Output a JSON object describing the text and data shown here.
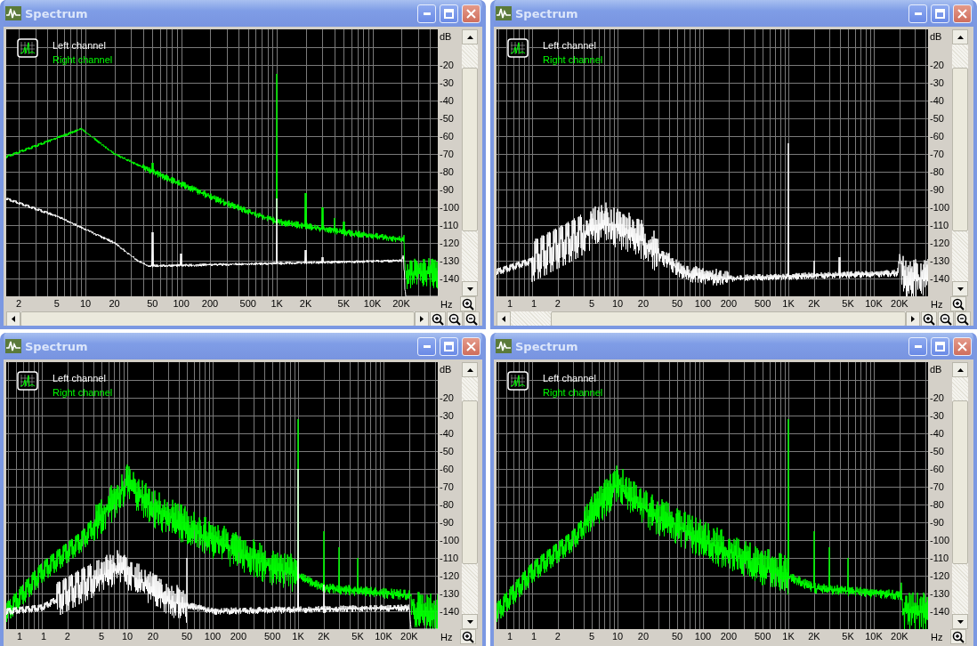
{
  "windows": [
    {
      "title": "Spectrum",
      "legend": [
        {
          "label": "Left channel",
          "color": "#ffffff"
        },
        {
          "label": "Right channel",
          "color": "#00ff00"
        }
      ],
      "y_unit": "dB",
      "y_ticks": [
        "-20",
        "-30",
        "-40",
        "-50",
        "-60",
        "-70",
        "-80",
        "-90",
        "-100",
        "-110",
        "-120",
        "-130",
        "-140"
      ],
      "x_unit": "Hz",
      "x_ticks": [
        "2",
        "5",
        "10",
        "20",
        "50",
        "100",
        "200",
        "500",
        "1K",
        "2K",
        "5K",
        "10K",
        "20K"
      ],
      "left_trace": true,
      "right_trace": true,
      "h_scrollbar": true
    },
    {
      "title": "Spectrum",
      "legend": [
        {
          "label": "Left channel",
          "color": "#ffffff"
        },
        {
          "label": "Right channel",
          "color": "#00ff00"
        }
      ],
      "y_unit": "dB",
      "y_ticks": [
        "-20",
        "-30",
        "-40",
        "-50",
        "-60",
        "-70",
        "-80",
        "-90",
        "-100",
        "-110",
        "-120",
        "-130",
        "-140"
      ],
      "x_unit": "Hz",
      "x_ticks": [
        "1",
        "1",
        "2",
        "5",
        "10",
        "20",
        "50",
        "100",
        "200",
        "500",
        "1K",
        "2K",
        "5K",
        "10K",
        "20K"
      ],
      "left_trace": true,
      "right_trace": false,
      "h_scrollbar": true
    },
    {
      "title": "Spectrum",
      "legend": [
        {
          "label": "Left channel",
          "color": "#ffffff"
        },
        {
          "label": "Right channel",
          "color": "#00ff00"
        }
      ],
      "y_unit": "dB",
      "y_ticks": [
        "-20",
        "-30",
        "-40",
        "-50",
        "-60",
        "-70",
        "-80",
        "-90",
        "-100",
        "-110",
        "-120",
        "-130",
        "-140"
      ],
      "x_unit": "Hz",
      "x_ticks": [
        "1",
        "1",
        "2",
        "5",
        "10",
        "20",
        "50",
        "100",
        "200",
        "500",
        "1K",
        "2K",
        "5K",
        "10K",
        "20K"
      ],
      "left_trace": true,
      "right_trace": true,
      "h_scrollbar": false
    },
    {
      "title": "Spectrum",
      "legend": [
        {
          "label": "Left channel",
          "color": "#ffffff"
        },
        {
          "label": "Right channel",
          "color": "#00ff00"
        }
      ],
      "y_unit": "dB",
      "y_ticks": [
        "-20",
        "-30",
        "-40",
        "-50",
        "-60",
        "-70",
        "-80",
        "-90",
        "-100",
        "-110",
        "-120",
        "-130",
        "-140"
      ],
      "x_unit": "Hz",
      "x_ticks": [
        "1",
        "1",
        "2",
        "5",
        "10",
        "20",
        "50",
        "100",
        "200",
        "500",
        "1K",
        "2K",
        "5K",
        "10K",
        "20K"
      ],
      "left_trace": false,
      "right_trace": true,
      "h_scrollbar": false
    }
  ]
}
